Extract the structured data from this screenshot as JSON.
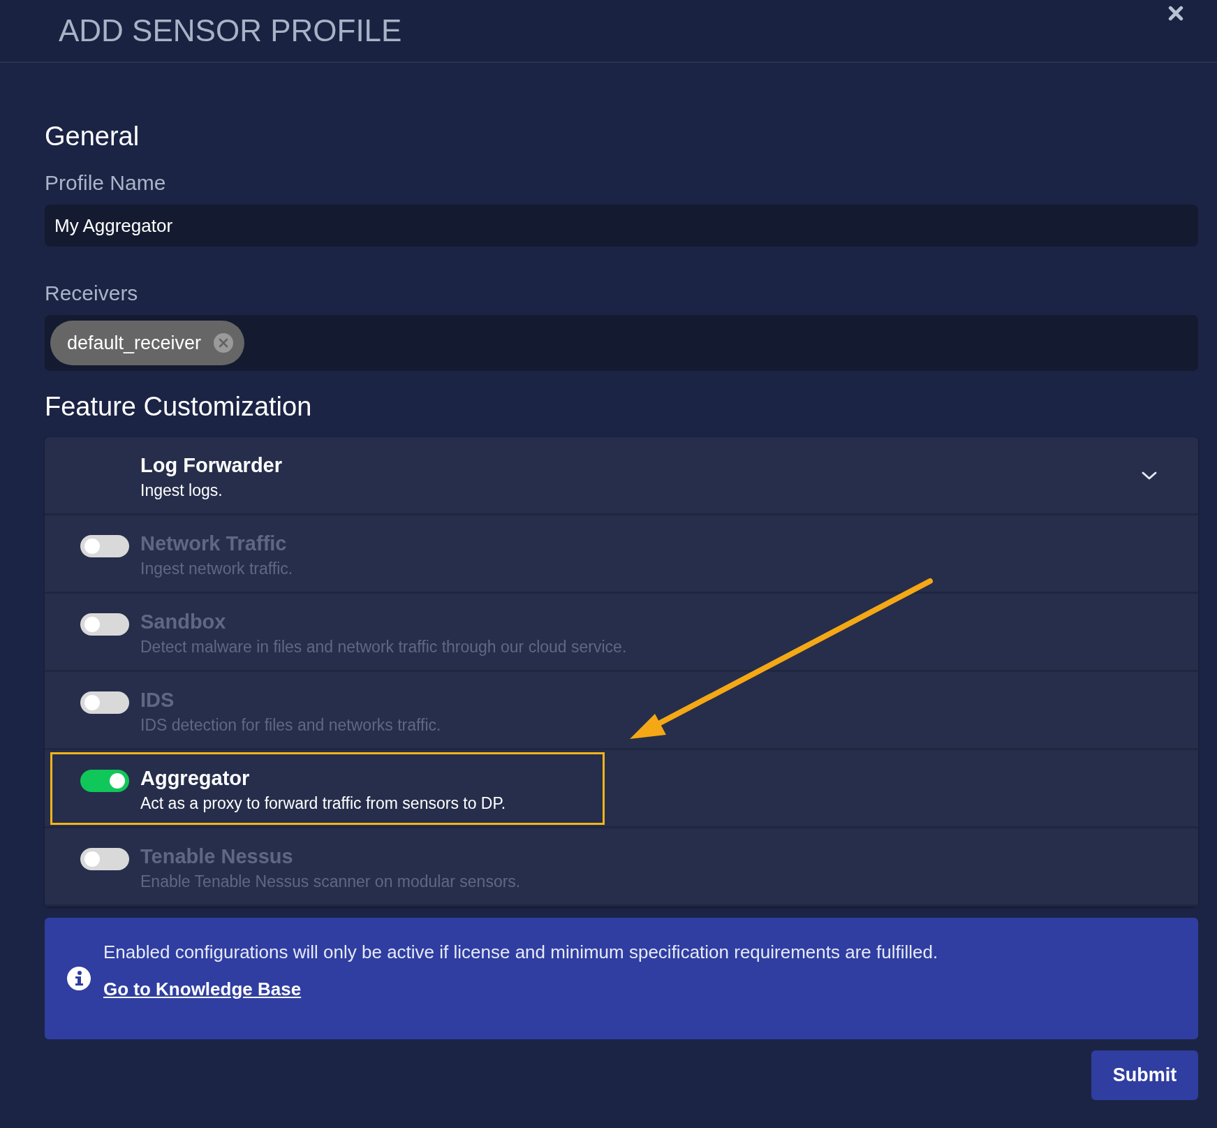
{
  "dialog": {
    "title": "ADD SENSOR PROFILE"
  },
  "general": {
    "heading": "General",
    "profile_name": {
      "label": "Profile Name",
      "value": "My Aggregator"
    },
    "receivers": {
      "label": "Receivers",
      "chips": [
        "default_receiver"
      ]
    }
  },
  "features": {
    "heading": "Feature Customization",
    "items": [
      {
        "kind": "group",
        "title": "Log Forwarder",
        "description": "Ingest logs."
      },
      {
        "kind": "toggle",
        "title": "Network Traffic",
        "description": "Ingest network traffic.",
        "on": false,
        "highlighted": false
      },
      {
        "kind": "toggle",
        "title": "Sandbox",
        "description": "Detect malware in files and network traffic through our cloud service.",
        "on": false,
        "highlighted": false
      },
      {
        "kind": "toggle",
        "title": "IDS",
        "description": "IDS detection for files and networks traffic.",
        "on": false,
        "highlighted": false
      },
      {
        "kind": "toggle",
        "title": "Aggregator",
        "description": "Act as a proxy to forward traffic from sensors to DP.",
        "on": true,
        "highlighted": true
      },
      {
        "kind": "toggle",
        "title": "Tenable Nessus",
        "description": "Enable Tenable Nessus scanner on modular sensors.",
        "on": false,
        "highlighted": false
      }
    ]
  },
  "notice": {
    "text": "Enabled configurations will only be active if license and minimum specification requirements are fulfilled.",
    "link": "Go to Knowledge Base"
  },
  "buttons": [
    "Submit"
  ]
}
